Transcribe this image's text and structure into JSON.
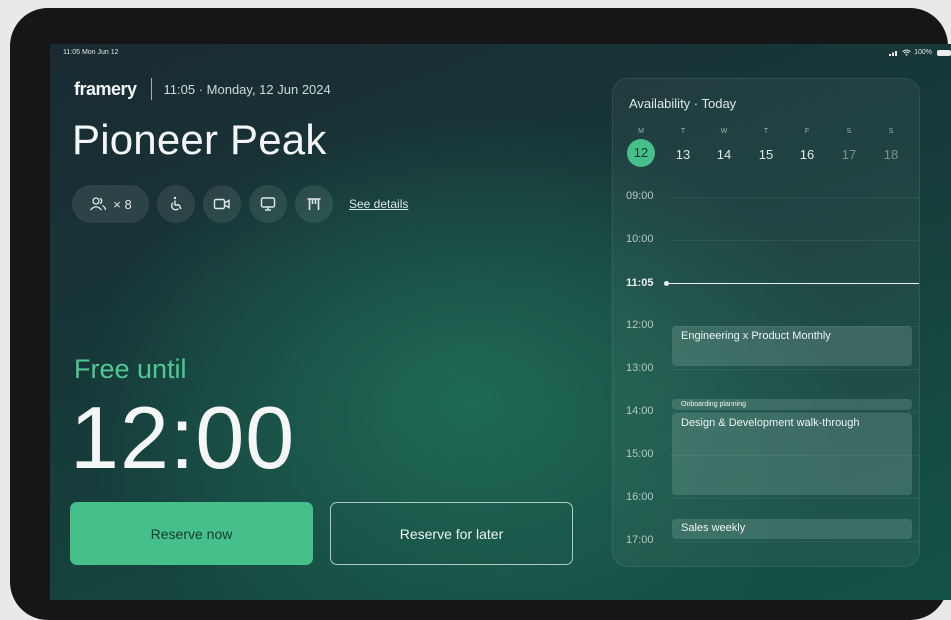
{
  "status_bar": {
    "time_date": "11:05 Mon Jun 12",
    "battery": "100%"
  },
  "header": {
    "brand": "framery",
    "datetime": "11:05 · Monday, 12 Jun 2024"
  },
  "room": {
    "name": "Pioneer Peak",
    "capacity_label": "× 8",
    "amenities": [
      "accessible-icon",
      "video-call-icon",
      "display-icon",
      "table-icon"
    ],
    "see_details": "See details"
  },
  "availability_status": {
    "label": "Free until",
    "time": "12:00"
  },
  "actions": {
    "reserve_now": "Reserve now",
    "reserve_later": "Reserve for later"
  },
  "availability_panel": {
    "title": "Availability · Today",
    "days": [
      {
        "dow": "M",
        "date": "12",
        "active": true
      },
      {
        "dow": "T",
        "date": "13"
      },
      {
        "dow": "W",
        "date": "14"
      },
      {
        "dow": "T",
        "date": "15"
      },
      {
        "dow": "F",
        "date": "16"
      },
      {
        "dow": "S",
        "date": "17",
        "weekend": true
      },
      {
        "dow": "S",
        "date": "18",
        "weekend": true
      }
    ],
    "hours": [
      "09:00",
      "10:00",
      "11:05",
      "12:00",
      "13:00",
      "14:00",
      "15:00",
      "16:00",
      "17:00"
    ],
    "current_time": "11:05",
    "events": [
      {
        "title": "Engineering x Product Monthly"
      },
      {
        "title": "Onboarding planning"
      },
      {
        "title": "Design & Development walk-through"
      },
      {
        "title": "Sales weekly"
      }
    ]
  },
  "colors": {
    "accent": "#46c08a",
    "free_text": "#4fc891"
  }
}
